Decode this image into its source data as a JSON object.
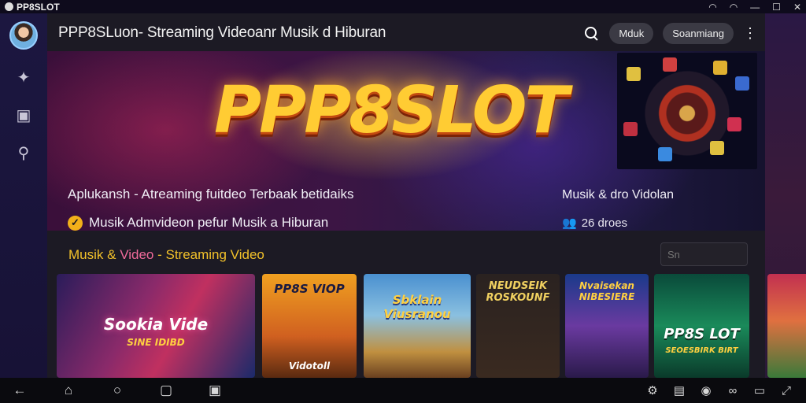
{
  "window": {
    "app_title": "PP8SLOT"
  },
  "header": {
    "title": "PPP8SLuon- Streaming Videoanr Musik d Hiburan",
    "pill_1": "Mduk",
    "pill_2": "Soanmiang"
  },
  "hero": {
    "logo": "PPP8SLOT",
    "subtitle": "Aplukansh - Atreaming fuitdeo Terbaak betidaiks",
    "tagline": "Musik Admvideon pefur Musik a Hiburan",
    "right_title": "Musik & dro Vidolan",
    "right_count": "26 droes"
  },
  "section": {
    "title_part1": "Musik & ",
    "title_part2": "Video",
    "title_part3": " - Streaming Video",
    "search_placeholder": "Sn"
  },
  "cards": [
    {
      "text": "Sookia Vide",
      "sub": "SINE IDIBD"
    },
    {
      "text": "PP8S VIOP",
      "sub": "Vidotoll"
    },
    {
      "text": "Sbklain Viusranou",
      "sub": ""
    },
    {
      "text": "NEUDSEIK ROSKOUNF",
      "sub": ""
    },
    {
      "text": "Nvaisekan NIBESIERE",
      "sub": ""
    },
    {
      "text": "PP8S LOT",
      "sub": "SEOESBIRK BIRT"
    }
  ],
  "colors": {
    "accent_yellow": "#f2c12a",
    "accent_pink": "#f06a9a",
    "logo_gold": "#ffcc33"
  }
}
